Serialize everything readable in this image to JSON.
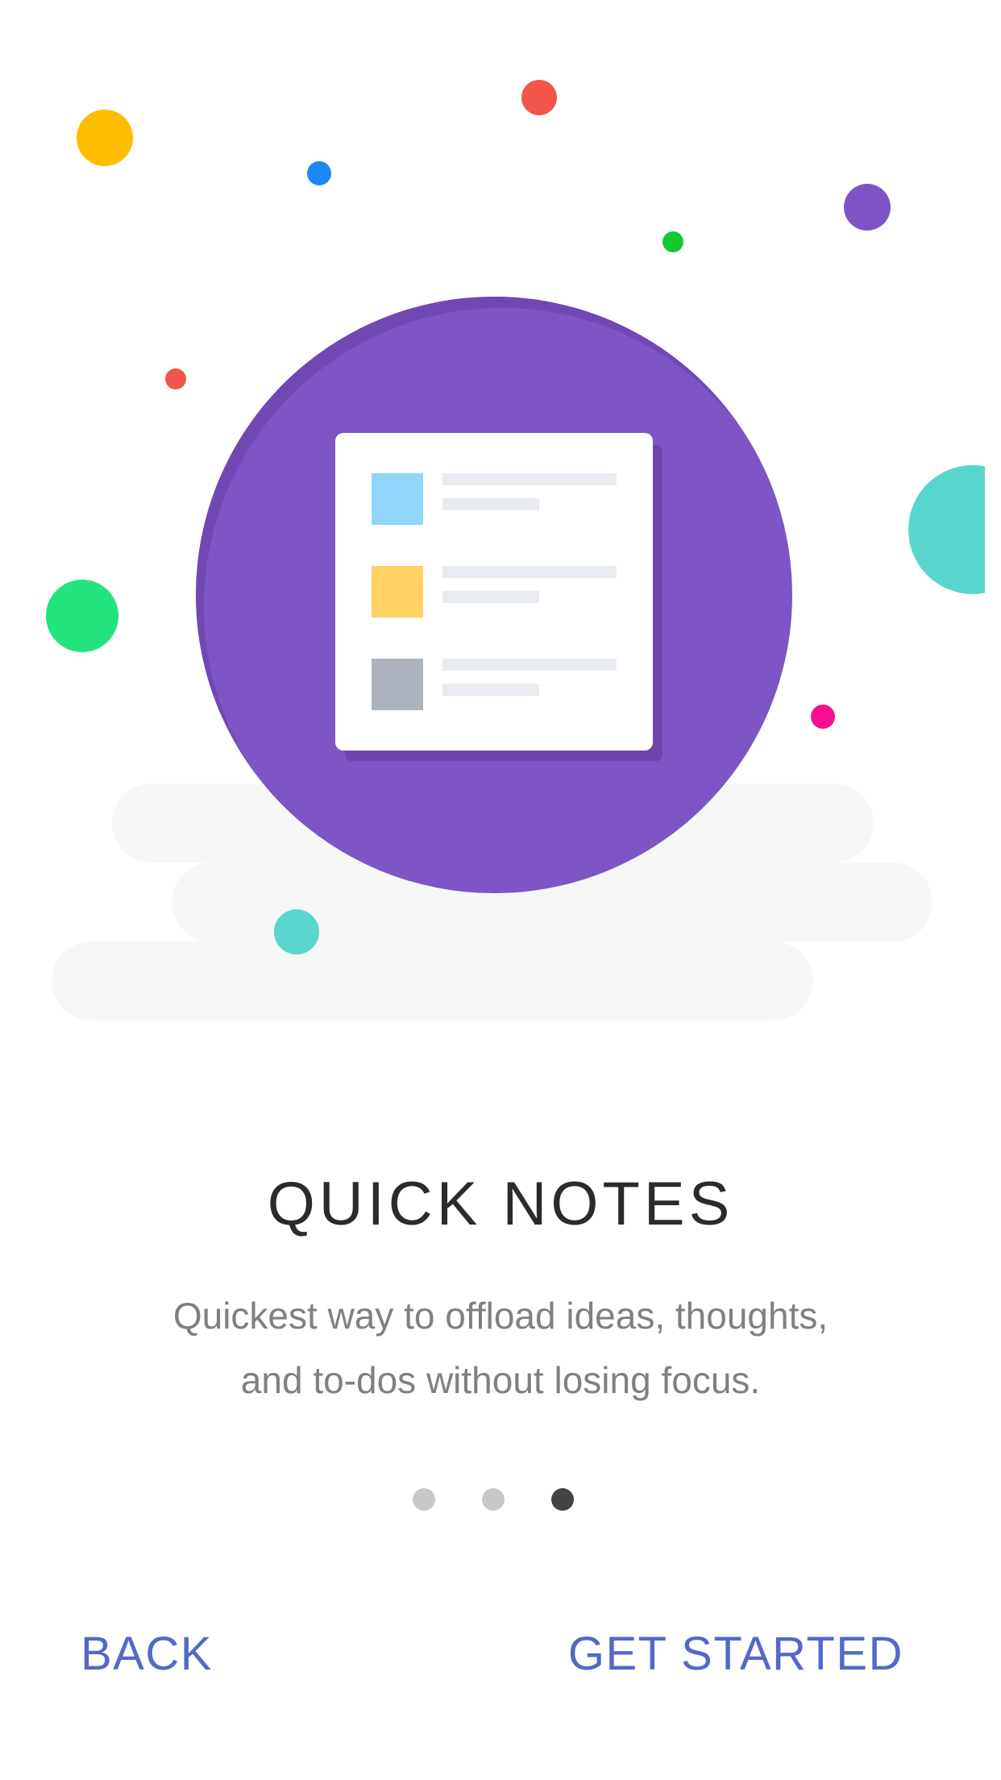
{
  "onboarding": {
    "title": "QUICK NOTES",
    "description_line1": "Quickest way to offload ideas, thoughts,",
    "description_line2": "and to-dos without losing focus.",
    "pager": {
      "total": 3,
      "active_index": 2
    },
    "back_label": "BACK",
    "get_started_label": "GET STARTED"
  },
  "illustration": {
    "icon": "notes-list-icon",
    "circle_color": "#7e55c5",
    "swatch_colors": [
      "#8fd6fa",
      "#ffd062",
      "#adb3bc"
    ]
  },
  "colors": {
    "accent": "#5468c6",
    "pager_active": "#444444",
    "pager_inactive": "#c8c8c8"
  }
}
